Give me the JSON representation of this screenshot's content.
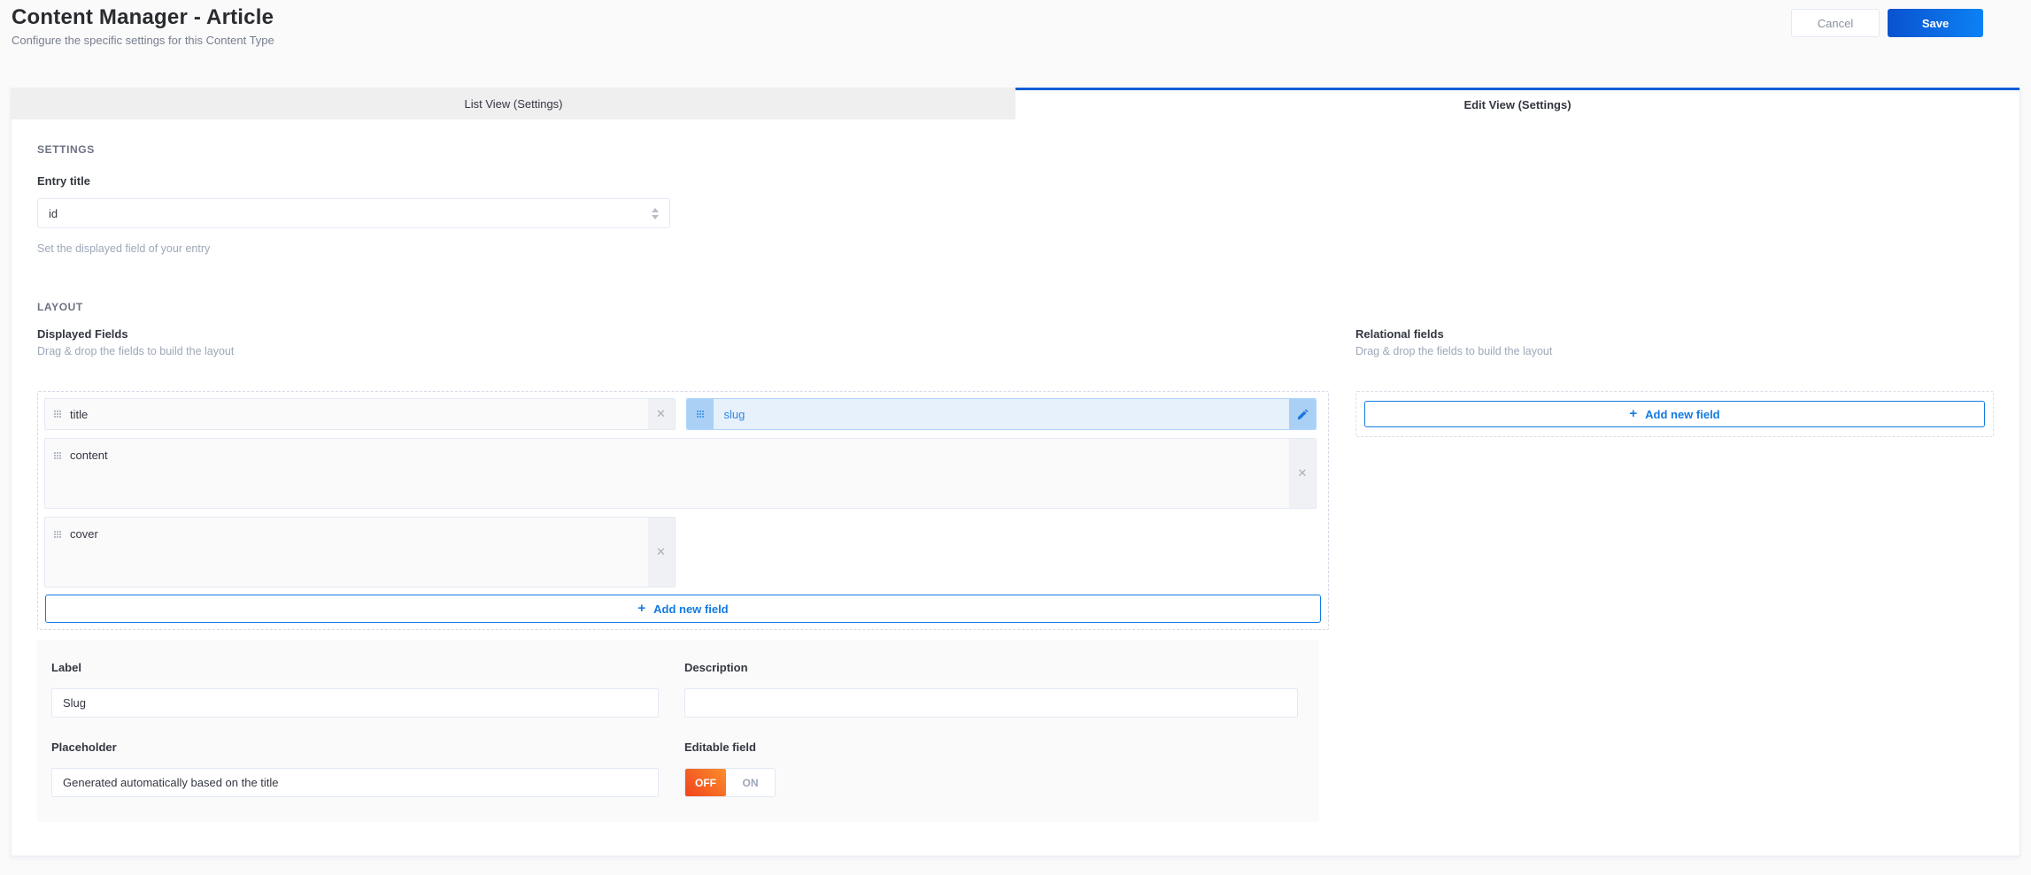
{
  "header": {
    "title": "Content Manager - Article",
    "subtitle": "Configure the specific settings for this Content Type",
    "cancel_label": "Cancel",
    "save_label": "Save"
  },
  "tabs": {
    "list_view": {
      "label": "List View (Settings)",
      "active": false
    },
    "edit_view": {
      "label": "Edit View (Settings)",
      "active": true
    }
  },
  "settings": {
    "section_title": "SETTINGS",
    "entry_title_label": "Entry title",
    "entry_title_value": "id",
    "entry_title_help": "Set the displayed field of your entry"
  },
  "layout": {
    "section_title": "LAYOUT",
    "displayed_fields": {
      "title": "Displayed Fields",
      "subtitle": "Drag & drop the fields to build the layout",
      "fields": [
        {
          "name": "title",
          "selected": false,
          "width": "half",
          "height": "small"
        },
        {
          "name": "slug",
          "selected": true,
          "width": "half",
          "height": "small"
        },
        {
          "name": "content",
          "selected": false,
          "width": "full",
          "height": "tall"
        },
        {
          "name": "cover",
          "selected": false,
          "width": "half",
          "height": "tall"
        }
      ],
      "add_button_label": "Add new field"
    },
    "relational_fields": {
      "title": "Relational fields",
      "subtitle": "Drag & drop the fields to build the layout",
      "add_button_label": "Add new field"
    }
  },
  "field_form": {
    "label_label": "Label",
    "label_value": "Slug",
    "description_label": "Description",
    "description_value": "",
    "placeholder_label": "Placeholder",
    "placeholder_value": "Generated automatically based on the title",
    "editable_label": "Editable field",
    "toggle": {
      "off_label": "OFF",
      "on_label": "ON",
      "value": "OFF"
    }
  },
  "icons": {
    "drag_handle": "drag-handle-dots",
    "close": "✕",
    "plus": "+",
    "edit": "pencil",
    "select_caret": "caret-up-down"
  },
  "colors": {
    "accent_blue": "#0b5ed7",
    "button_blue": "#137ae3",
    "save_gradient_start": "#0a51cf",
    "save_gradient_end": "#0c82f4",
    "selected_chip_bg": "#e7f1fc",
    "selected_chip_border": "#aed4fb",
    "toggle_off_gradient_start": "#fb8e2c",
    "toggle_off_gradient_end": "#f1431d",
    "page_bg": "#fafafb",
    "tab_inactive_bg": "#efefef"
  }
}
